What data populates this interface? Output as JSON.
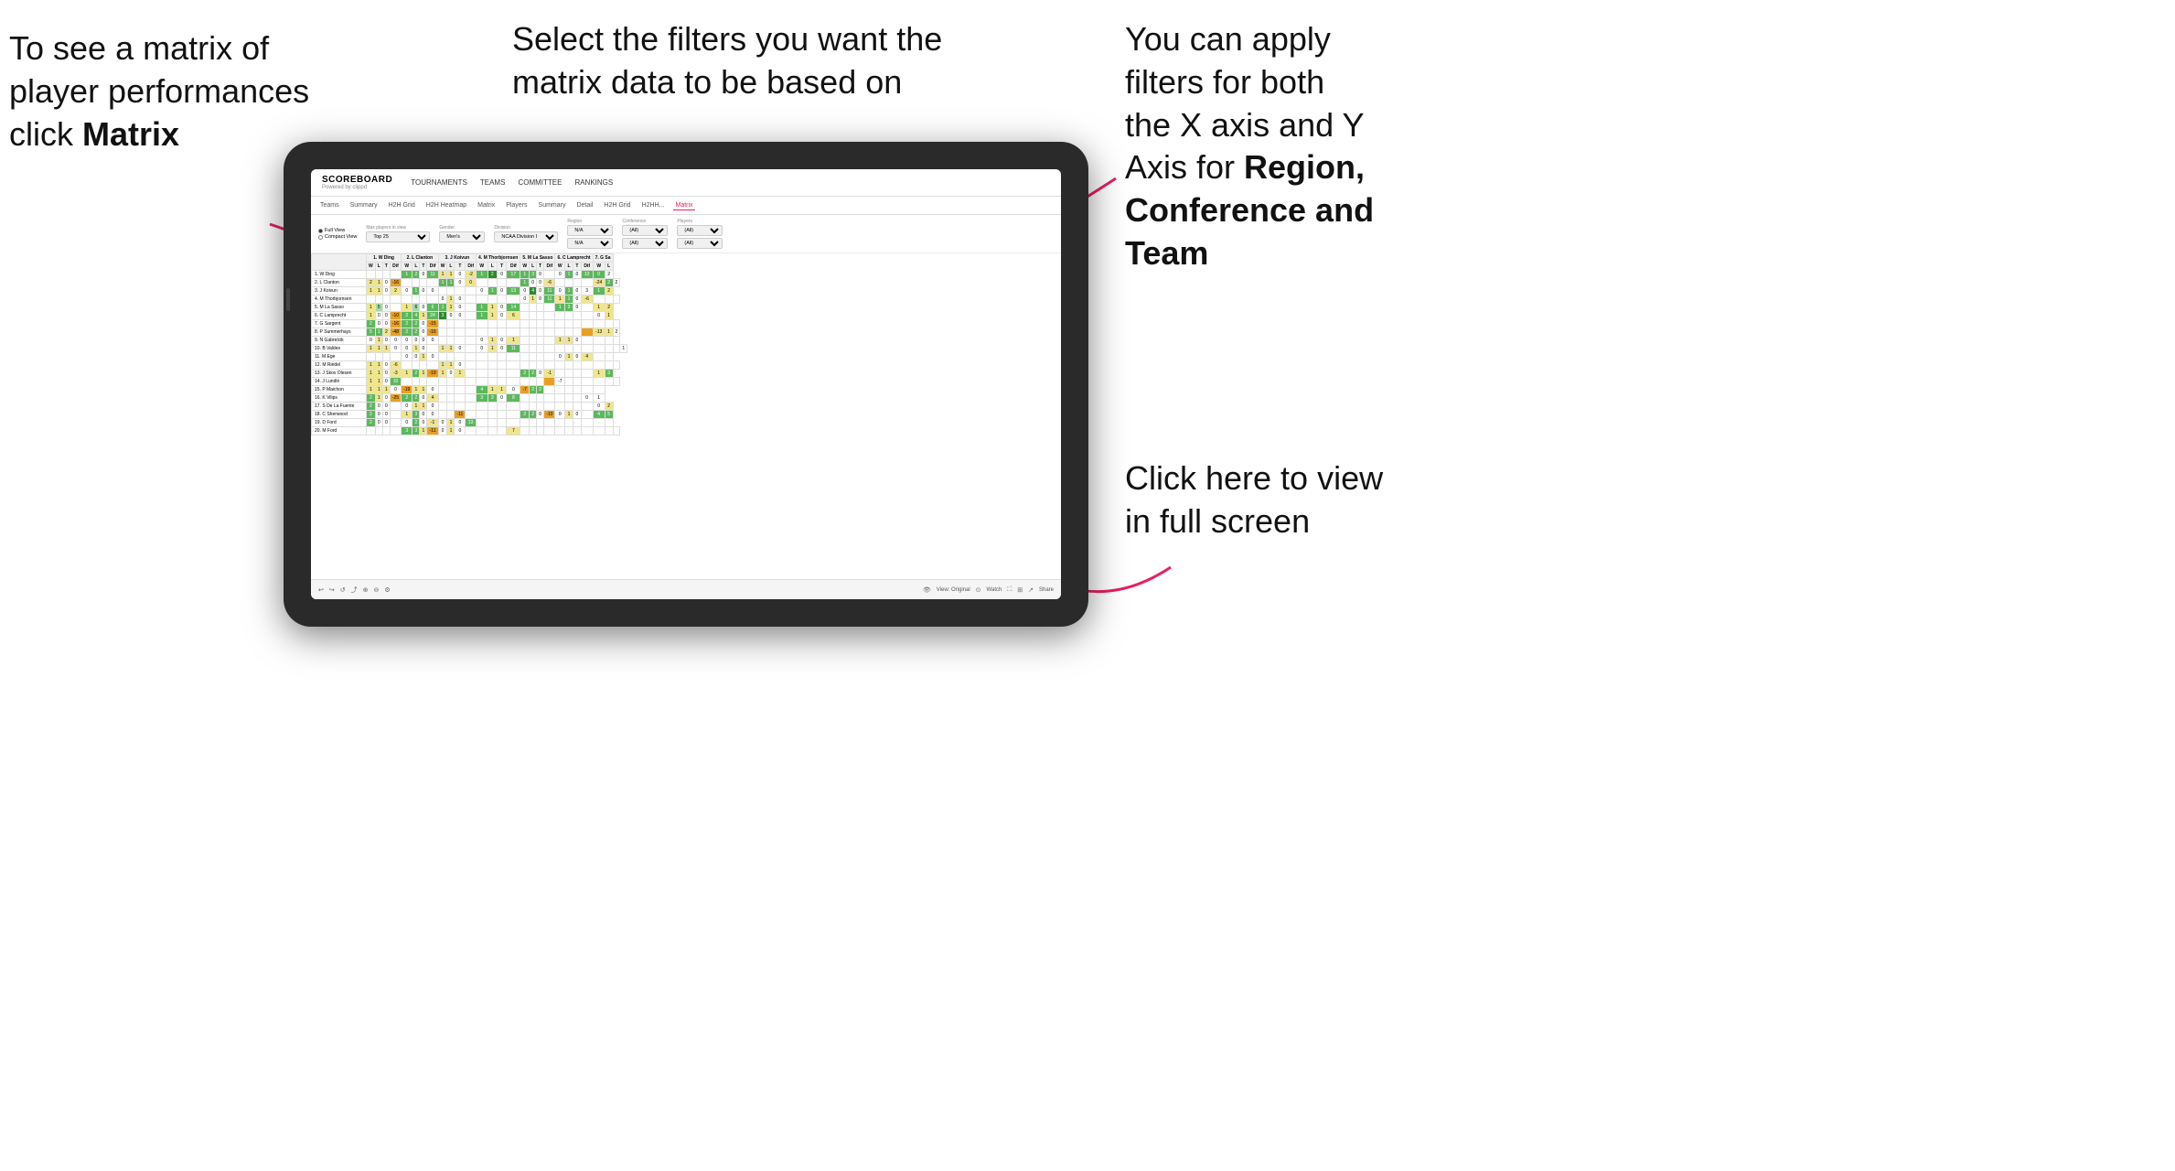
{
  "annotations": {
    "topleft": {
      "line1": "To see a matrix of",
      "line2": "player performances",
      "line3_prefix": "click ",
      "line3_bold": "Matrix"
    },
    "topmid": {
      "text": "Select the filters you want the matrix data to be based on"
    },
    "topright": {
      "line1": "You  can apply",
      "line2": "filters for both",
      "line3": "the X axis and Y",
      "line4_prefix": "Axis for ",
      "line4_bold": "Region,",
      "line5_bold": "Conference and",
      "line6_bold": "Team"
    },
    "bottomright": {
      "line1": "Click here to view",
      "line2": "in full screen"
    }
  },
  "app": {
    "logo": "SCOREBOARD",
    "powered_by": "Powered by clippd",
    "nav": [
      "TOURNAMENTS",
      "TEAMS",
      "COMMITTEE",
      "RANKINGS"
    ],
    "subnav": [
      "Teams",
      "Summary",
      "H2H Grid",
      "H2H Heatmap",
      "Matrix",
      "Players",
      "Summary",
      "Detail",
      "H2H Grid",
      "H2HH...",
      "Matrix"
    ],
    "active_tab": "Matrix"
  },
  "filters": {
    "view_options": [
      "Full View",
      "Compact View"
    ],
    "selected_view": "Full View",
    "max_players_label": "Max players in view",
    "max_players_value": "Top 25",
    "gender_label": "Gender",
    "gender_value": "Men's",
    "division_label": "Division",
    "division_value": "NCAA Division I",
    "region_label": "Region",
    "region_value": "N/A",
    "conference_label": "Conference",
    "conference_value": "(All)",
    "conference_value2": "(All)",
    "players_label": "Players",
    "players_value": "(All)",
    "players_value2": "(All)"
  },
  "matrix": {
    "column_players": [
      "1. W Ding",
      "2. L Clanton",
      "3. J Koivun",
      "4. M Thorbjornsen",
      "5. M La Sasso",
      "6. C Lamprecht",
      "7. G Sa"
    ],
    "col_subheaders": [
      "W",
      "L",
      "T",
      "Dif"
    ],
    "rows": [
      {
        "name": "1. W Ding",
        "cells": [
          "",
          "",
          "",
          "",
          "1",
          "2",
          "0",
          "11",
          "1",
          "1",
          "0",
          "-2",
          "1",
          "2",
          "0",
          "17",
          "1",
          "3",
          "0",
          "",
          "0",
          "1",
          "0",
          "13",
          "0",
          "2"
        ]
      },
      {
        "name": "2. L Clanton",
        "cells": [
          "2",
          "1",
          "0",
          "-16",
          "",
          "",
          "",
          "",
          "1",
          "1",
          "0",
          "0",
          "",
          "",
          "",
          "",
          "1",
          "0",
          "0",
          "-6",
          "",
          "",
          "",
          "",
          "-24",
          "2",
          "2"
        ]
      },
      {
        "name": "3. J Koivun",
        "cells": [
          "1",
          "1",
          "0",
          "2",
          "0",
          "1",
          "0",
          "0",
          "",
          "",
          "",
          "",
          "0",
          "1",
          "0",
          "13",
          "0",
          "4",
          "0",
          "11",
          "0",
          "1",
          "0",
          "3",
          "1",
          "2"
        ]
      },
      {
        "name": "4. M Thorbjornsen",
        "cells": [
          "",
          "",
          "",
          "",
          "",
          "",
          "",
          "",
          "0",
          "1",
          "0",
          "",
          "",
          "",
          "",
          "",
          "0",
          "1",
          "0",
          "11",
          "1",
          "1",
          "0",
          "-6",
          "",
          "",
          ""
        ]
      },
      {
        "name": "5. M La Sasso",
        "cells": [
          "1",
          "5",
          "0",
          "",
          "1",
          "6",
          "0",
          "6",
          "1",
          "1",
          "0",
          "",
          "1",
          "1",
          "0",
          "14",
          "",
          "",
          "",
          "",
          "1",
          "3",
          "0",
          "",
          "1",
          "2"
        ]
      },
      {
        "name": "6. C Lamprecht",
        "cells": [
          "1",
          "0",
          "0",
          "-10",
          "2",
          "4",
          "1",
          "24",
          "3",
          "0",
          "0",
          "",
          "1",
          "1",
          "0",
          "6",
          "",
          "",
          "",
          "",
          "",
          "",
          "",
          "",
          "0",
          "1"
        ]
      },
      {
        "name": "7. G Sargent",
        "cells": [
          "2",
          "0",
          "0",
          "-16",
          "2",
          "2",
          "0",
          "-15",
          "",
          "",
          "",
          "",
          "",
          "",
          "",
          "",
          "",
          "",
          "",
          "",
          "",
          "",
          "",
          "",
          "",
          "",
          ""
        ]
      },
      {
        "name": "8. P Summerhays",
        "cells": [
          "5",
          "1",
          "2",
          "-48",
          "2",
          "2",
          "0",
          "-16",
          "",
          "",
          "",
          "",
          "",
          "",
          "",
          "",
          "",
          "",
          "",
          "",
          "",
          "",
          "",
          "",
          "-13",
          "1",
          "2"
        ]
      },
      {
        "name": "9. N Gabrelcik",
        "cells": [
          "0",
          "1",
          "0",
          "0",
          "0",
          "0",
          "0",
          "0",
          "",
          "",
          "",
          "",
          "0",
          "1",
          "0",
          "1",
          "",
          "",
          "",
          "",
          "1",
          "1",
          "0",
          "",
          "",
          "",
          ""
        ]
      },
      {
        "name": "10. B Valdes",
        "cells": [
          "1",
          "1",
          "1",
          "0",
          "0",
          "1",
          "0",
          "",
          "1",
          "1",
          "0",
          "",
          "0",
          "1",
          "0",
          "11",
          "",
          "",
          "",
          "",
          "",
          "",
          "",
          "",
          "",
          "",
          "",
          "1"
        ]
      },
      {
        "name": "11. M Ege",
        "cells": [
          "",
          "",
          "",
          "",
          "0",
          "0",
          "1",
          "0",
          "",
          "",
          "",
          "",
          "",
          "",
          "",
          "",
          "",
          "",
          "",
          "",
          "0",
          "1",
          "0",
          "4",
          "",
          ""
        ]
      },
      {
        "name": "12. M Riedel",
        "cells": [
          "1",
          "1",
          "0",
          "-6",
          "",
          "",
          "",
          "",
          "1",
          "1",
          "0",
          "",
          "",
          "",
          "",
          "",
          "",
          "",
          "",
          "",
          "",
          "",
          "",
          "",
          "",
          "",
          ""
        ]
      },
      {
        "name": "13. J Skov Olesen",
        "cells": [
          "1",
          "1",
          "0",
          "-3",
          "1",
          "2",
          "1",
          "-19",
          "1",
          "0",
          "1",
          "",
          "",
          "",
          "",
          "",
          "2",
          "2",
          "0",
          "-1",
          "",
          "",
          "",
          "",
          "1",
          "3"
        ]
      },
      {
        "name": "14. J Lundin",
        "cells": [
          "1",
          "1",
          "0",
          "10",
          "",
          "",
          "",
          "",
          "",
          "",
          "",
          "",
          "",
          "",
          "",
          "",
          "",
          "",
          "",
          "",
          "-7",
          "",
          "",
          "",
          "",
          "",
          ""
        ]
      },
      {
        "name": "15. P Maichon",
        "cells": [
          "1",
          "1",
          "1",
          "0",
          "-19",
          "1",
          "1",
          "0",
          "",
          "",
          "",
          "",
          "4",
          "1",
          "1",
          "0",
          "-7",
          "2",
          "2",
          "",
          "",
          "",
          "",
          "",
          ""
        ]
      },
      {
        "name": "16. K Vilips",
        "cells": [
          "2",
          "1",
          "0",
          "-25",
          "2",
          "2",
          "0",
          "4",
          "",
          "",
          "",
          "",
          "3",
          "3",
          "0",
          "8",
          "",
          "",
          "",
          "",
          "",
          "",
          "",
          "0",
          "1"
        ]
      },
      {
        "name": "17. S De La Fuente",
        "cells": [
          "2",
          "0",
          "0",
          "",
          "0",
          "1",
          "1",
          "0",
          "",
          "",
          "",
          "",
          "",
          "",
          "",
          "",
          "",
          "",
          "",
          "",
          "",
          "",
          "",
          "",
          "0",
          "2"
        ]
      },
      {
        "name": "18. C Sherwood",
        "cells": [
          "2",
          "0",
          "0",
          "",
          "1",
          "3",
          "0",
          "0",
          "",
          "",
          "-11",
          "",
          "",
          "",
          "",
          "",
          "2",
          "2",
          "0",
          "-10",
          "0",
          "1",
          "0",
          "",
          "4",
          "5"
        ]
      },
      {
        "name": "19. D Ford",
        "cells": [
          "2",
          "0",
          "0",
          "",
          "0",
          "2",
          "0",
          "-1",
          "0",
          "1",
          "0",
          "13",
          "",
          "",
          "",
          "",
          "",
          "",
          "",
          "",
          "",
          "",
          "",
          "",
          "",
          ""
        ]
      },
      {
        "name": "20. M Ford",
        "cells": [
          "",
          "",
          "",
          "",
          "3",
          "3",
          "1",
          "-11",
          "0",
          "1",
          "0",
          "",
          "",
          "",
          "",
          "7",
          "",
          "",
          "",
          "",
          "",
          "",
          "",
          "",
          "",
          "",
          ""
        ]
      }
    ]
  },
  "toolbar": {
    "view_label": "View: Original",
    "watch_label": "Watch",
    "share_label": "Share"
  }
}
